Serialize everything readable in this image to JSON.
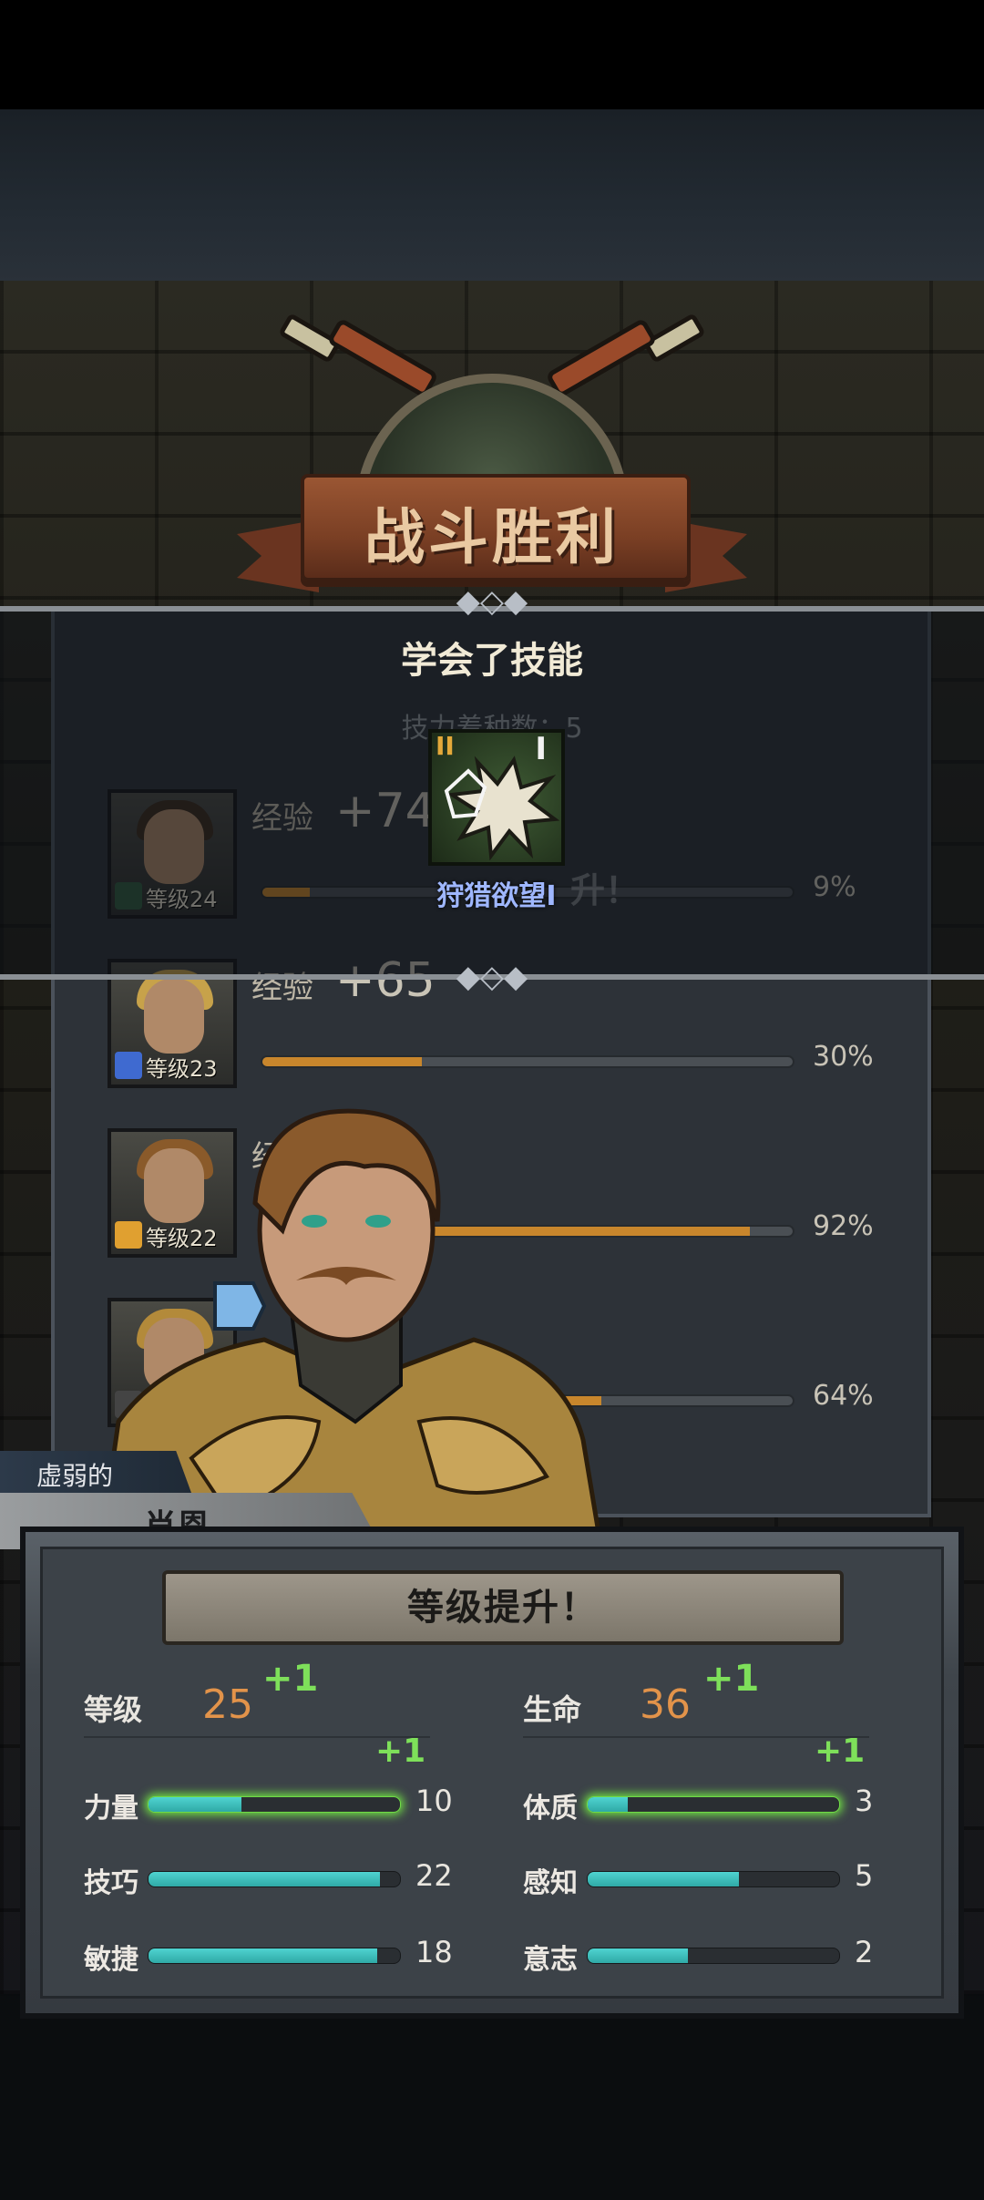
{
  "title": "战斗胜利",
  "skill_popup": {
    "heading": "学会了技能",
    "faded_line": "技力着种数：5",
    "skill_name": "狩猎欲望I",
    "skill_tier": "II",
    "skill_rank": "I"
  },
  "party": [
    {
      "exp_label": "经验",
      "exp_gain": "+74",
      "level_text": "等级24",
      "progress": 0.09,
      "pct_text": "9%",
      "overlay_text": "升！",
      "class_color": "#2f5b3f",
      "hair_color": "#3a2a1c"
    },
    {
      "exp_label": "经验",
      "exp_gain": "+65",
      "level_text": "等级23",
      "progress": 0.3,
      "pct_text": "30%",
      "class_color": "#3f6ad0",
      "hair_color": "#c7a24a"
    },
    {
      "exp_label": "经",
      "exp_gain": "",
      "level_text": "等级22",
      "progress": 0.92,
      "pct_text": "92%",
      "class_color": "#e0a030",
      "hair_color": "#8a5a2a"
    },
    {
      "exp_label": "",
      "exp_gain": "",
      "level_text": "",
      "progress": 0.64,
      "pct_text": "64%",
      "class_color": "#444",
      "hair_color": "#b38a3a"
    }
  ],
  "hero": {
    "trait": "虚弱的",
    "name": "肖恩"
  },
  "level_up": {
    "banner": "等级提升！",
    "level": {
      "label": "等级",
      "value": "25",
      "gain": "+1"
    },
    "life": {
      "label": "生命",
      "value": "36",
      "gain": "+1"
    },
    "attributes_left": [
      {
        "label": "力量",
        "value": "10",
        "fill": 0.37,
        "gain": "+1",
        "highlight": true
      },
      {
        "label": "技巧",
        "value": "22",
        "fill": 0.92,
        "gain": "",
        "highlight": false
      },
      {
        "label": "敏捷",
        "value": "18",
        "fill": 0.91,
        "gain": "",
        "highlight": false
      }
    ],
    "attributes_right": [
      {
        "label": "体质",
        "value": "3",
        "fill": 0.16,
        "gain": "+1",
        "highlight": true
      },
      {
        "label": "感知",
        "value": "5",
        "fill": 0.6,
        "gain": "",
        "highlight": false
      },
      {
        "label": "意志",
        "value": "2",
        "fill": 0.4,
        "gain": "",
        "highlight": false
      }
    ]
  },
  "colors": {
    "accent_orange": "#e2934a",
    "gain_green": "#7ee05a",
    "bar_teal": "#3ec1be",
    "exp_bar": "#c8862c"
  },
  "icons": [
    "crossed-swords-icon",
    "shield-icon",
    "skill-burst-icon",
    "class-shield-icon",
    "class-sword-icon"
  ]
}
